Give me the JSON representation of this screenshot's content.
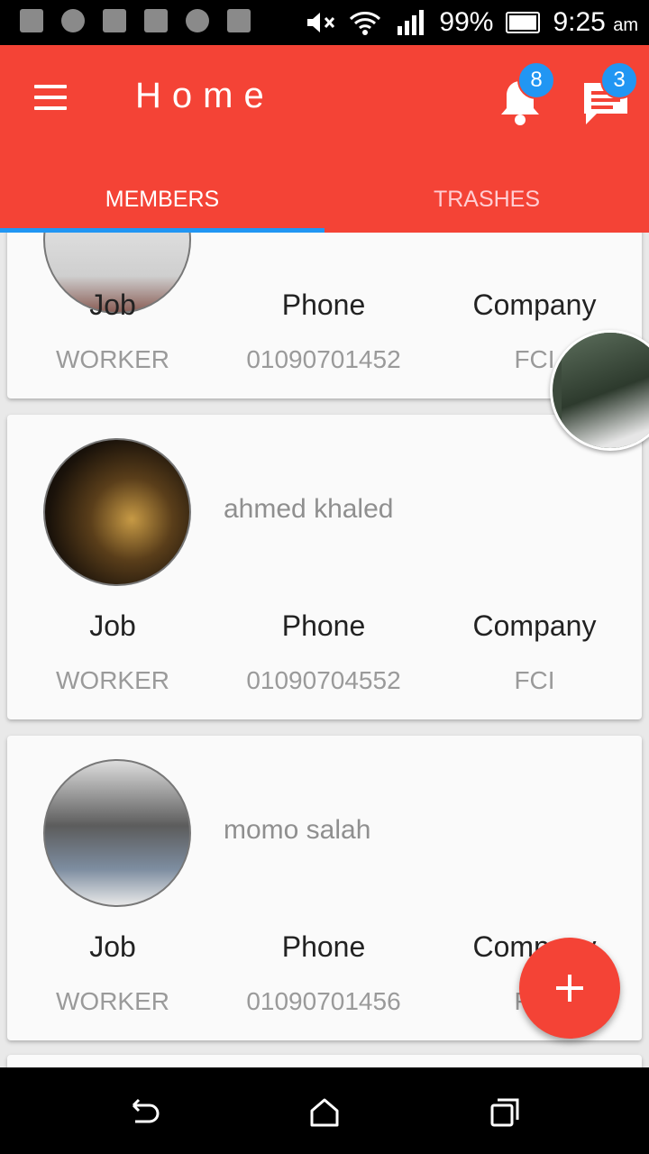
{
  "status_bar": {
    "battery": "99%",
    "time": "9:25",
    "ampm": "am",
    "left_icons": [
      "add-box-icon",
      "shield-icon",
      "facebook-icon",
      "youtube-icon",
      "cat-icon",
      "gmail-icon"
    ],
    "right_icons": [
      "mute-icon",
      "wifi-icon",
      "signal-icon",
      "battery-icon"
    ]
  },
  "app_bar": {
    "title": "Home",
    "notifications_count": "8",
    "messages_count": "3",
    "color": "#f44336",
    "badge_color": "#2196f3"
  },
  "tabs": [
    {
      "label": "MEMBERS",
      "active": true
    },
    {
      "label": "TRASHES",
      "active": false
    }
  ],
  "members": [
    {
      "name": "",
      "job_label": "Job",
      "job": "WORKER",
      "phone_label": "Phone",
      "phone": "01090701452",
      "company_label": "Company",
      "company": "FCI"
    },
    {
      "name": "ahmed khaled",
      "job_label": "Job",
      "job": "WORKER",
      "phone_label": "Phone",
      "phone": "01090704552",
      "company_label": "Company",
      "company": "FCI"
    },
    {
      "name": "momo salah",
      "job_label": "Job",
      "job": "WORKER",
      "phone_label": "Phone",
      "phone": "01090701456",
      "company_label": "Company",
      "company": "FCI"
    }
  ],
  "fab": {
    "icon": "plus-icon",
    "label": "+"
  },
  "nav_bar": {
    "icons": [
      "back-icon",
      "home-icon",
      "recents-icon"
    ]
  }
}
